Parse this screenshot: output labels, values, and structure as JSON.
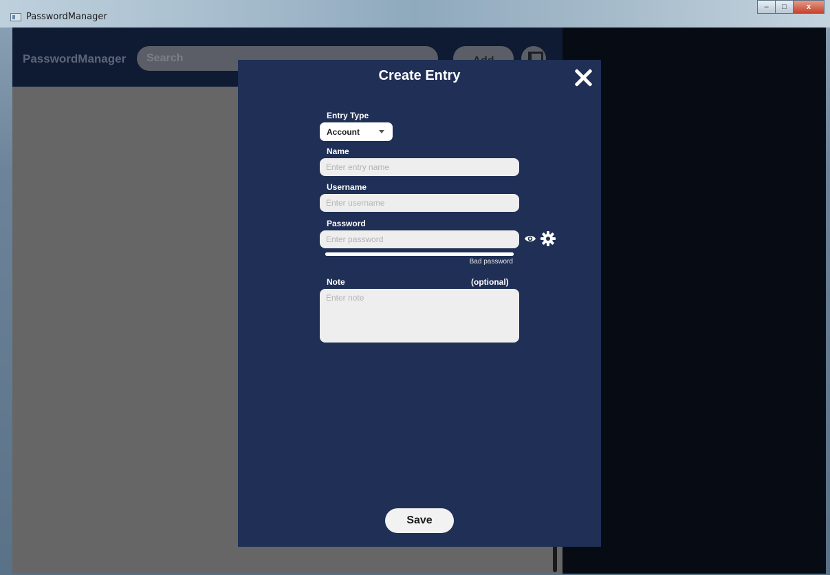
{
  "window": {
    "title": "PasswordManager",
    "controls": {
      "minimize": "–",
      "maximize": "□",
      "close": "x"
    }
  },
  "header": {
    "brand": "PasswordManager",
    "search_placeholder": "Search",
    "add_label": "Add",
    "exit_icon": "sign-out-icon"
  },
  "modal": {
    "title": "Create Entry",
    "close_icon": "close-icon",
    "entry_type_label": "Entry Type",
    "entry_type_value": "Account",
    "name_label": "Name",
    "name_placeholder": "Enter entry name",
    "username_label": "Username",
    "username_placeholder": "Enter username",
    "password_label": "Password",
    "password_placeholder": "Enter password",
    "password_strength_text": "Bad password",
    "password_strength_fraction": 1.0,
    "note_label": "Note",
    "note_optional": "(optional)",
    "note_placeholder": "Enter note",
    "save_label": "Save"
  },
  "colors": {
    "modal_bg": "#1f2f55",
    "header_bg": "#0f1a33",
    "list_bg": "#666666",
    "backdrop": "#070b14"
  }
}
